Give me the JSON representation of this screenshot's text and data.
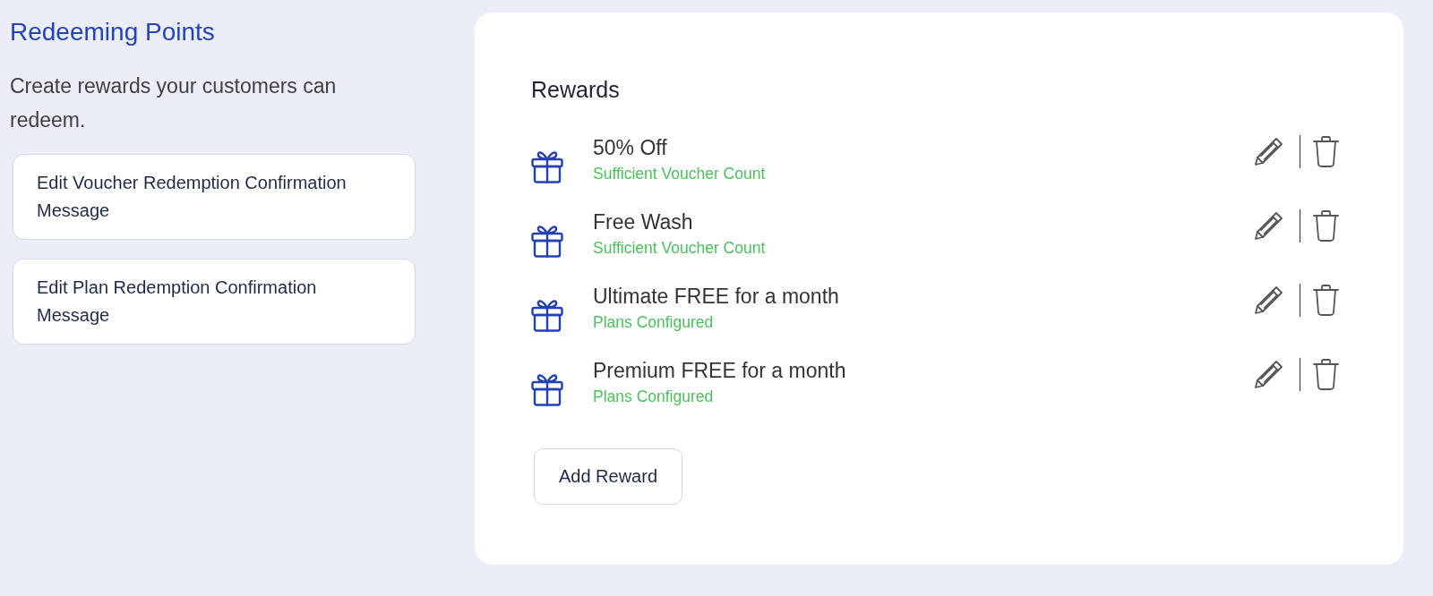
{
  "sidebar": {
    "title": "Redeeming Points",
    "description": "Create rewards your customers can redeem.",
    "buttons": [
      "Edit Voucher Redemption Confirmation Message",
      "Edit Plan Redemption Confirmation Message"
    ]
  },
  "rewards": {
    "title": "Rewards",
    "items": [
      {
        "name": "50% Off",
        "status": "Sufficient Voucher Count"
      },
      {
        "name": "Free Wash",
        "status": "Sufficient Voucher Count"
      },
      {
        "name": "Ultimate FREE for a month",
        "status": "Plans Configured"
      },
      {
        "name": "Premium FREE for a month",
        "status": "Plans Configured"
      }
    ],
    "add_button": "Add Reward"
  }
}
